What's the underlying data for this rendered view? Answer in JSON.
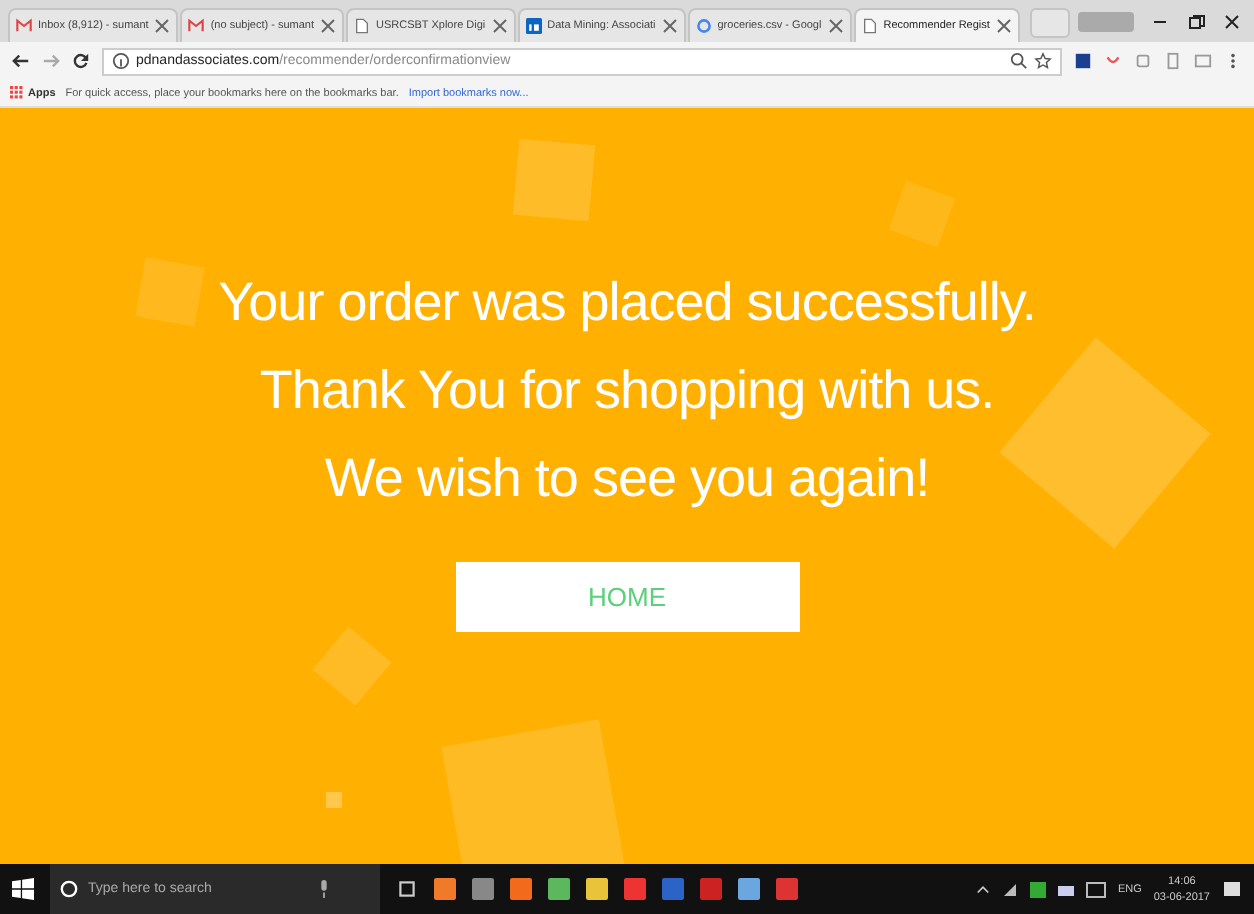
{
  "tabs": [
    {
      "title": "Inbox (8,912) - sumant",
      "kind": "mail",
      "selected": false
    },
    {
      "title": "(no subject) - sumant",
      "kind": "mail",
      "selected": false
    },
    {
      "title": "USRCSBT Xplore Digi",
      "kind": "page",
      "selected": false
    },
    {
      "title": "Data Mining: Associati",
      "kind": "linkedin",
      "selected": false
    },
    {
      "title": "groceries.csv - Googl",
      "kind": "google",
      "selected": false
    },
    {
      "title": "Recommender Regist",
      "kind": "page",
      "selected": true
    }
  ],
  "address_bar": {
    "domain": "pdnandassociates.com",
    "path": "/recommender/orderconfirmationview"
  },
  "bookmarks_bar": {
    "apps": "Apps",
    "hint": "For quick access, place your bookmarks here on the bookmarks bar.",
    "import_link": "Import bookmarks now..."
  },
  "page": {
    "lines": [
      "Your order was placed successfully.",
      "Thank You for shopping with us.",
      "We wish to see you again!"
    ],
    "button": "HOME"
  },
  "taskbar": {
    "search_placeholder": "Type here to search",
    "language": "ENG",
    "time": "14:06",
    "date": "03-06-2017"
  }
}
